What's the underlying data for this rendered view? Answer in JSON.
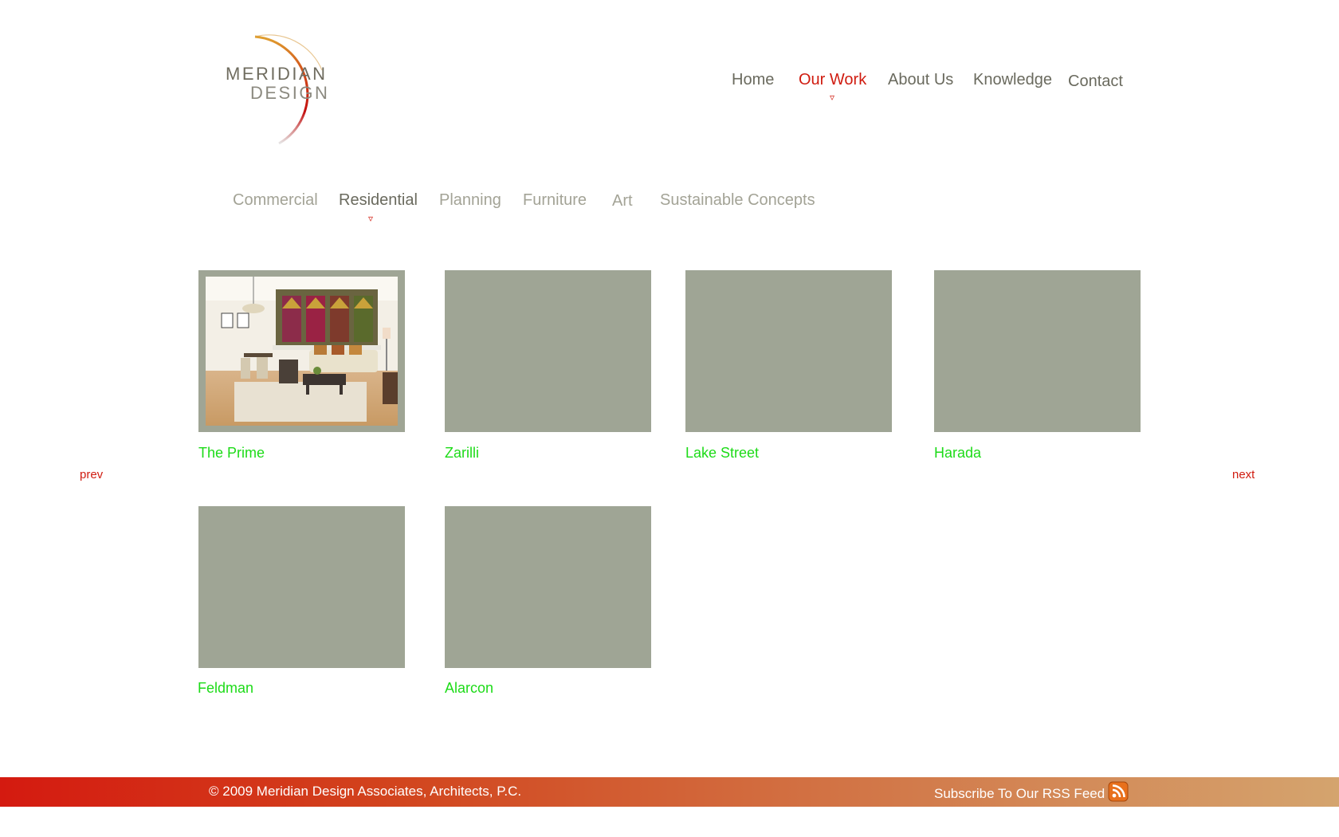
{
  "brand": {
    "line1": "MERIDIAN",
    "line2": "DESIGN",
    "accent_color": "#d01c10"
  },
  "nav": {
    "items": [
      "Home",
      "Our Work",
      "About Us",
      "Knowledge",
      "Contact"
    ],
    "active": "Our Work",
    "marker": "▿"
  },
  "subnav": {
    "items": [
      "Commercial",
      "Residential",
      "Planning",
      "Furniture",
      "Art",
      "Sustainable Concepts"
    ],
    "active": "Residential",
    "marker": "▿"
  },
  "gallery": {
    "projects": [
      {
        "title": "The Prime",
        "has_image": true
      },
      {
        "title": "Zarilli",
        "has_image": false
      },
      {
        "title": "Lake Street",
        "has_image": false
      },
      {
        "title": "Harada",
        "has_image": false
      },
      {
        "title": "Feldman",
        "has_image": false
      },
      {
        "title": "Alarcon",
        "has_image": false
      }
    ],
    "prev": "prev",
    "next": "next"
  },
  "footer": {
    "copyright": "© 2009 Meridian Design Associates, Architects, P.C.",
    "rss_text": "Subscribe To Our RSS Feed",
    "rss_icon": "rss-feed-icon"
  }
}
